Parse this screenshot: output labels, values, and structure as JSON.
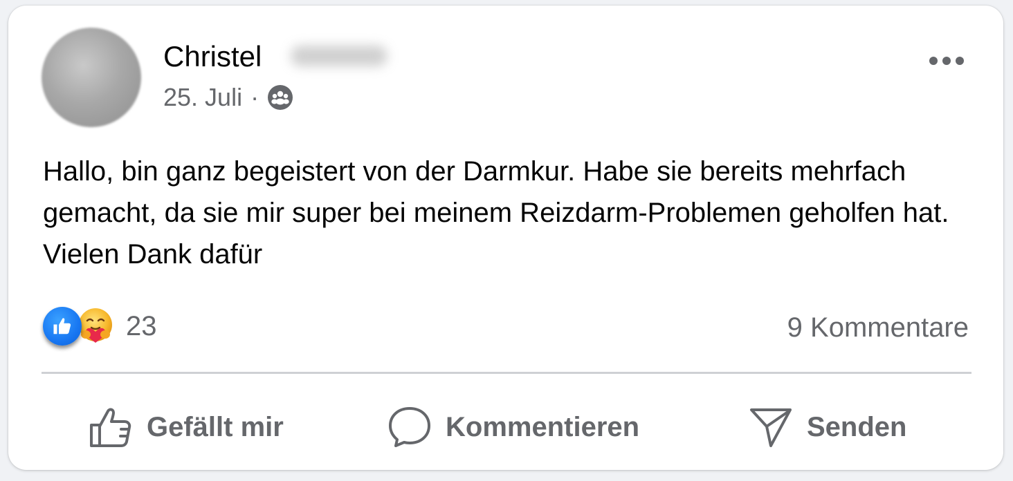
{
  "post": {
    "author_first_name": "Christel",
    "date": "25. Juli",
    "separator": "·",
    "audience_icon": "group-icon",
    "more_icon": "more-dots-icon",
    "text": "Hallo, bin ganz begeistert von der Darmkur. Habe sie bereits mehrfach gemacht, da sie mir super bei meinem Reizdarm-Problemen geholfen hat. Vielen Dank dafür"
  },
  "stats": {
    "reaction_icons": [
      "like-icon",
      "care-icon"
    ],
    "reaction_count": "23",
    "comments_label": "9 Kommentare"
  },
  "actions": {
    "like_label": "Gefällt mir",
    "comment_label": "Kommentieren",
    "send_label": "Senden"
  },
  "colors": {
    "like_blue": "#1877f2",
    "secondary_text": "#65676b",
    "primary_text": "#050505",
    "divider": "#ced0d4"
  }
}
